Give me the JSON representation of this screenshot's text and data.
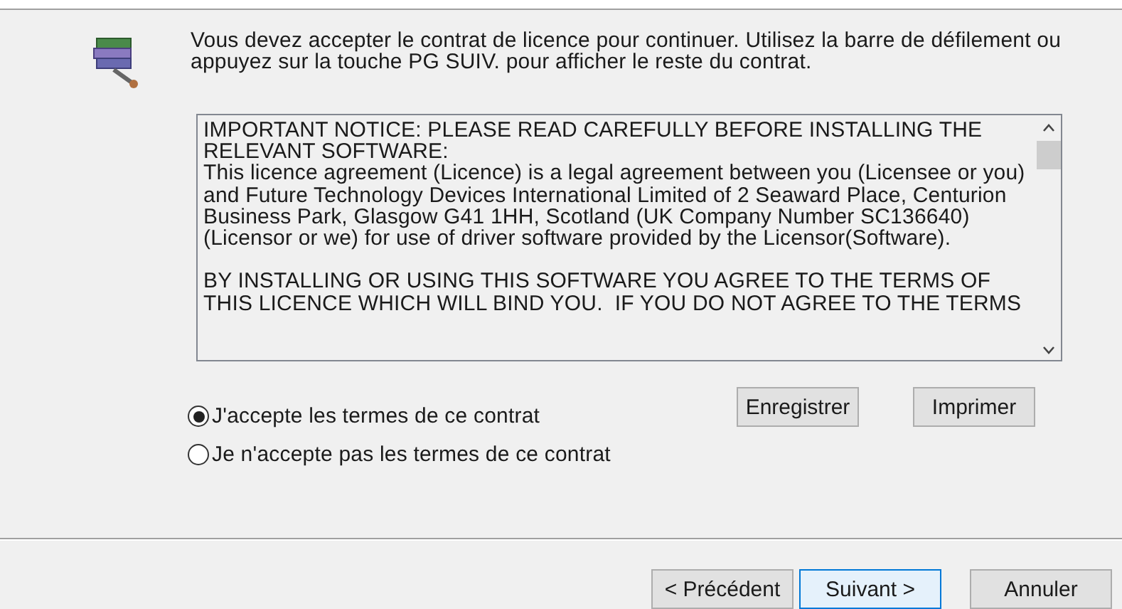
{
  "intro": "Vous devez accepter le contrat de licence pour continuer. Utilisez la barre de défilement ou appuyez sur la touche PG SUIV. pour afficher le reste du contrat.",
  "license_paragraphs": [
    [
      "IMPORTANT NOTICE: PLEASE READ CAREFULLY BEFORE INSTALLING THE",
      "RELEVANT SOFTWARE:",
      "This licence agreement (Licence) is a legal agreement between you (Licensee or you)",
      "and Future Technology Devices International Limited of 2 Seaward Place, Centurion",
      "Business Park, Glasgow G41 1HH, Scotland (UK Company Number SC136640)",
      "(Licensor or we) for use of driver software provided by the Licensor(Software)."
    ],
    [
      "BY INSTALLING OR USING THIS SOFTWARE YOU AGREE TO THE TERMS OF",
      "THIS LICENCE WHICH WILL BIND YOU.  IF YOU DO NOT AGREE TO THE TERMS"
    ]
  ],
  "options": [
    {
      "label": "J'accepte les termes de ce contrat",
      "selected": true
    },
    {
      "label": "Je n'accepte pas les termes de ce contrat",
      "selected": false
    }
  ],
  "side_buttons": [
    "Enregistrer",
    "Imprimer"
  ],
  "nav_buttons": [
    {
      "label": "< Précédent",
      "default": false
    },
    {
      "label": "Suivant >",
      "default": true
    },
    {
      "label": "Annuler",
      "default": false
    }
  ]
}
